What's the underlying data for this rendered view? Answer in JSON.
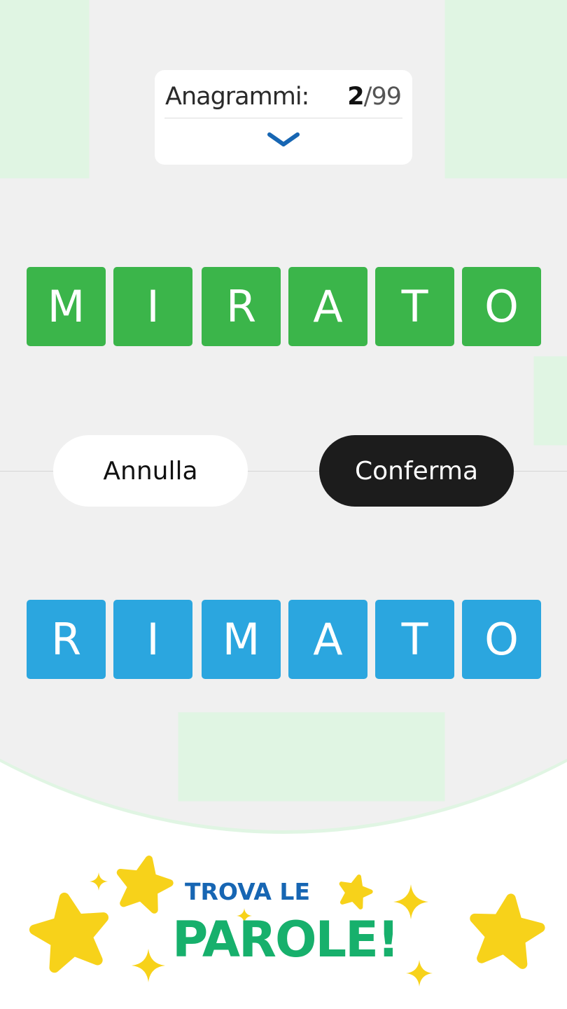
{
  "counter": {
    "label": "Anagrammi:",
    "current": "2",
    "separator": "/",
    "total": "99"
  },
  "icons": {
    "expand": "chevron-down-icon",
    "decoration": "star-icon"
  },
  "colors": {
    "correct_tile": "#3bb54a",
    "input_tile": "#2ba6df",
    "chevron": "#1766b3",
    "confirm_button": "#1c1c1c",
    "promo_title_blue": "#1766b3",
    "promo_title_green": "#17b06c",
    "star": "#f7d21a"
  },
  "target_word": {
    "letters": [
      "M",
      "I",
      "R",
      "A",
      "T",
      "O"
    ]
  },
  "buttons": {
    "cancel": "Annulla",
    "confirm": "Conferma"
  },
  "input_word": {
    "letters": [
      "R",
      "I",
      "M",
      "A",
      "T",
      "O"
    ]
  },
  "promo": {
    "line1": "TROVA LE",
    "line2": "PAROLE!"
  }
}
